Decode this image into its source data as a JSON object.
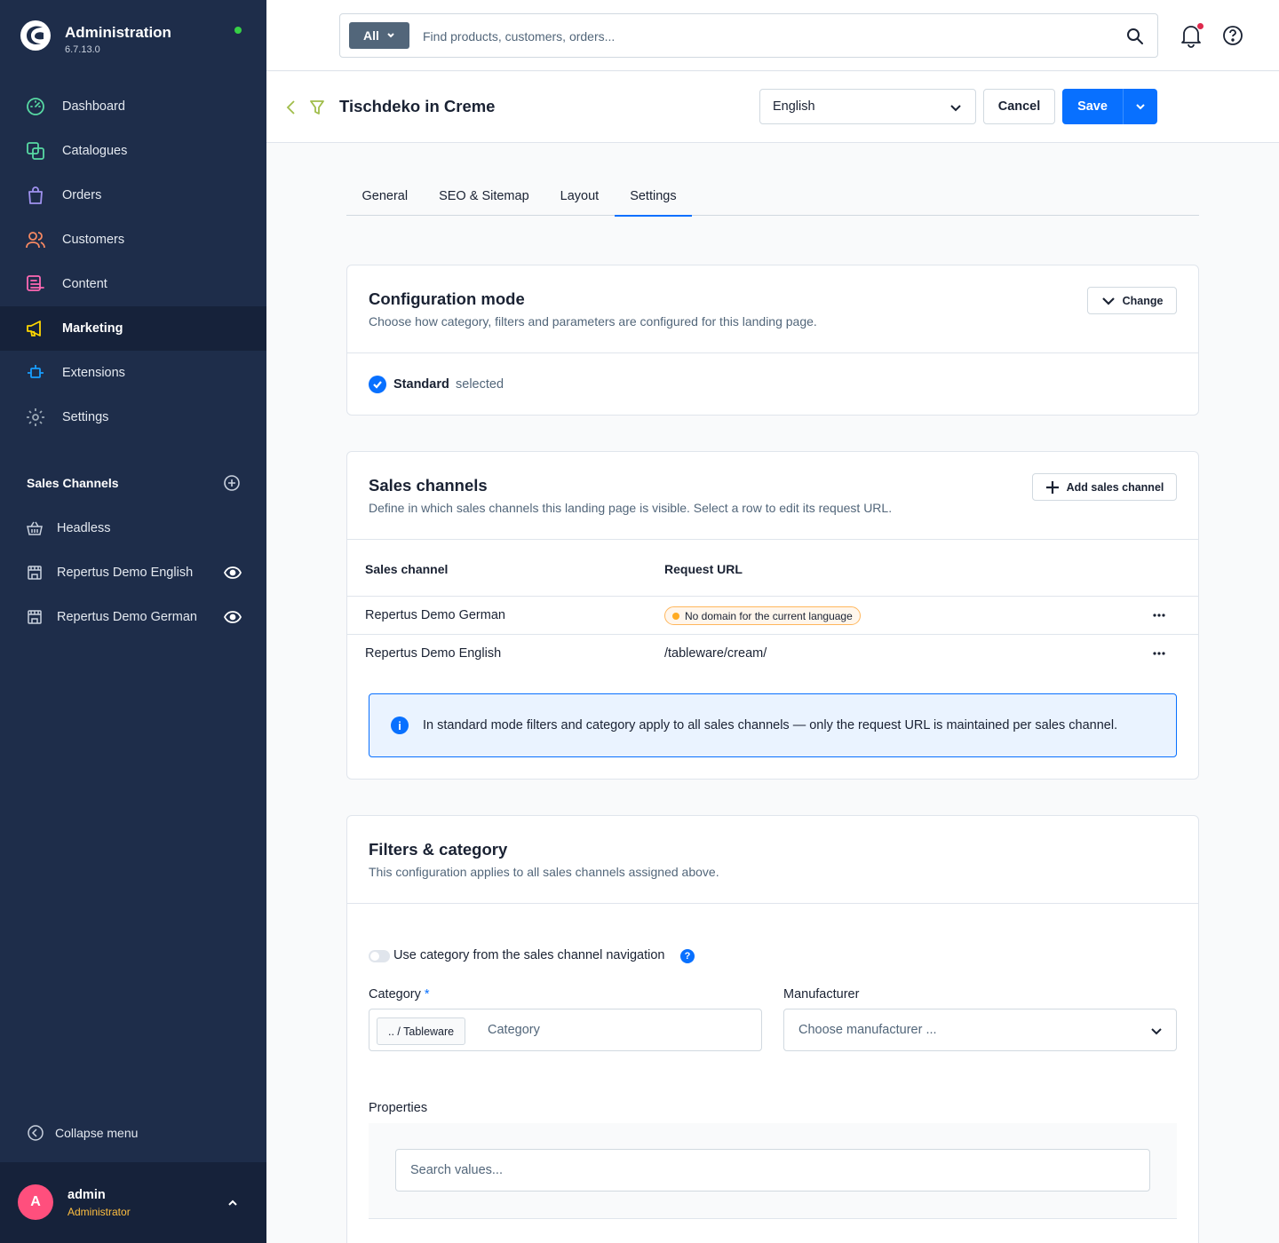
{
  "sidebar": {
    "brand_title": "Administration",
    "brand_version": "6.7.13.0",
    "nav": [
      {
        "label": "Dashboard",
        "icon": "dashboard-icon",
        "color": "#57d9a3"
      },
      {
        "label": "Catalogues",
        "icon": "catalogue-icon",
        "color": "#57d9a3"
      },
      {
        "label": "Orders",
        "icon": "orders-icon",
        "color": "#a092f0"
      },
      {
        "label": "Customers",
        "icon": "customers-icon",
        "color": "#f88962"
      },
      {
        "label": "Content",
        "icon": "content-icon",
        "color": "#ff68b4"
      },
      {
        "label": "Marketing",
        "icon": "marketing-icon",
        "color": "#ffd700",
        "active": true
      },
      {
        "label": "Extensions",
        "icon": "extensions-icon",
        "color": "#189eff"
      },
      {
        "label": "Settings",
        "icon": "settings-icon",
        "color": "#9aa8b5"
      }
    ],
    "sales_channels_title": "Sales Channels",
    "sales_channels": [
      {
        "label": "Headless",
        "icon": "basket-icon"
      },
      {
        "label": "Repertus Demo English",
        "icon": "storefront-icon",
        "eye": true
      },
      {
        "label": "Repertus Demo German",
        "icon": "storefront-icon",
        "eye": true
      }
    ],
    "collapse_label": "Collapse menu",
    "user": {
      "initial": "A",
      "name": "admin",
      "role": "Administrator"
    }
  },
  "topbar": {
    "search_type": "All",
    "search_placeholder": "Find products, customers, orders..."
  },
  "header": {
    "title": "Tischdeko in Creme",
    "language": "English",
    "cancel_label": "Cancel",
    "save_label": "Save"
  },
  "tabs": [
    {
      "label": "General"
    },
    {
      "label": "SEO & Sitemap"
    },
    {
      "label": "Layout"
    },
    {
      "label": "Settings",
      "active": true
    }
  ],
  "config_mode": {
    "title": "Configuration mode",
    "subtitle": "Choose how category, filters and parameters are configured for this landing page.",
    "change_label": "Change",
    "selected_mode": "Standard",
    "selected_suffix": "selected"
  },
  "sales_channels_card": {
    "title": "Sales channels",
    "subtitle": "Define in which sales channels this landing page is visible. Select a row to edit its request URL.",
    "add_label": "Add sales channel",
    "col_channel": "Sales channel",
    "col_url": "Request URL",
    "rows": [
      {
        "channel": "Repertus Demo German",
        "url": "No domain for the current language",
        "warning": true
      },
      {
        "channel": "Repertus Demo English",
        "url": "/tableware/cream/",
        "warning": false
      }
    ],
    "info": "In standard mode filters and category apply to all sales channels — only the request URL is maintained per sales channel."
  },
  "filters_card": {
    "title": "Filters & category",
    "subtitle": "This configuration applies to all sales channels assigned above.",
    "toggle_label": "Use category from the sales channel navigation",
    "toggle_on": false,
    "help": "?",
    "category_label": "Category",
    "category_required": "*",
    "category_chip": ".. / Tableware",
    "category_placeholder": "Category",
    "manufacturer_label": "Manufacturer",
    "manufacturer_placeholder": "Choose manufacturer ...",
    "properties_label": "Properties",
    "properties_search_placeholder": "Search values..."
  }
}
